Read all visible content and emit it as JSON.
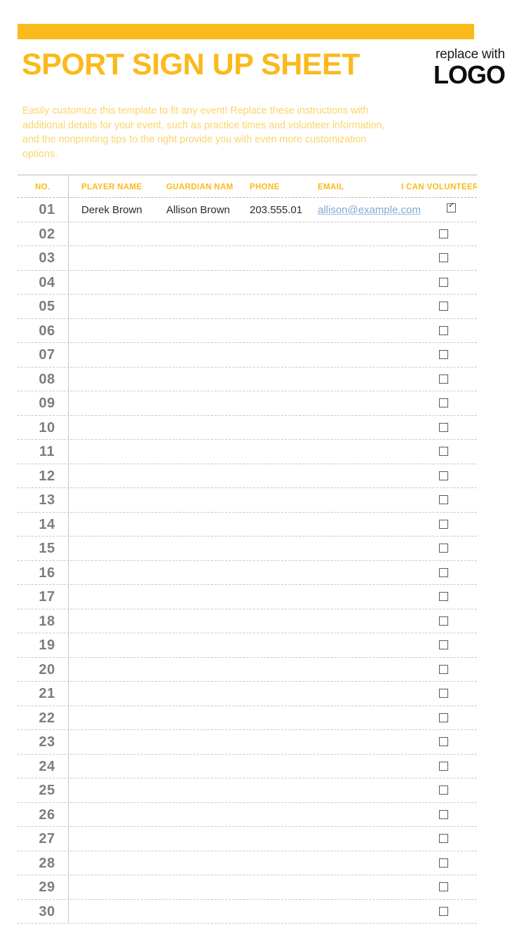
{
  "page": {
    "accent_color": "#FABA1B",
    "title": "SPORT SIGN UP SHEET",
    "intro": "Easily customize this template to fit any event! Replace these instructions with additional details for your event, such as practice times and volunteer information, and the nonprinting tips to the right provide you with even more customization options."
  },
  "logo": {
    "line1": "replace with",
    "line2": "LOGO"
  },
  "table": {
    "headers": {
      "no": "NO.",
      "player_name": "PLAYER NAME",
      "guardian_name": "GUARDIAN NAM",
      "phone": "PHONE",
      "email": "EMAIL",
      "volunteer": "I CAN VOLUNTEER"
    },
    "rows": [
      {
        "no": "01",
        "player_name": "Derek Brown",
        "guardian_name": "Allison Brown",
        "phone": "203.555.01",
        "email": "allison@example.com",
        "volunteer": true
      },
      {
        "no": "02",
        "player_name": "",
        "guardian_name": "",
        "phone": "",
        "email": "",
        "volunteer": false
      },
      {
        "no": "03",
        "player_name": "",
        "guardian_name": "",
        "phone": "",
        "email": "",
        "volunteer": false
      },
      {
        "no": "04",
        "player_name": "",
        "guardian_name": "",
        "phone": "",
        "email": "",
        "volunteer": false
      },
      {
        "no": "05",
        "player_name": "",
        "guardian_name": "",
        "phone": "",
        "email": "",
        "volunteer": false
      },
      {
        "no": "06",
        "player_name": "",
        "guardian_name": "",
        "phone": "",
        "email": "",
        "volunteer": false
      },
      {
        "no": "07",
        "player_name": "",
        "guardian_name": "",
        "phone": "",
        "email": "",
        "volunteer": false
      },
      {
        "no": "08",
        "player_name": "",
        "guardian_name": "",
        "phone": "",
        "email": "",
        "volunteer": false
      },
      {
        "no": "09",
        "player_name": "",
        "guardian_name": "",
        "phone": "",
        "email": "",
        "volunteer": false
      },
      {
        "no": "10",
        "player_name": "",
        "guardian_name": "",
        "phone": "",
        "email": "",
        "volunteer": false
      },
      {
        "no": "11",
        "player_name": "",
        "guardian_name": "",
        "phone": "",
        "email": "",
        "volunteer": false
      },
      {
        "no": "12",
        "player_name": "",
        "guardian_name": "",
        "phone": "",
        "email": "",
        "volunteer": false
      },
      {
        "no": "13",
        "player_name": "",
        "guardian_name": "",
        "phone": "",
        "email": "",
        "volunteer": false
      },
      {
        "no": "14",
        "player_name": "",
        "guardian_name": "",
        "phone": "",
        "email": "",
        "volunteer": false
      },
      {
        "no": "15",
        "player_name": "",
        "guardian_name": "",
        "phone": "",
        "email": "",
        "volunteer": false
      },
      {
        "no": "16",
        "player_name": "",
        "guardian_name": "",
        "phone": "",
        "email": "",
        "volunteer": false
      },
      {
        "no": "17",
        "player_name": "",
        "guardian_name": "",
        "phone": "",
        "email": "",
        "volunteer": false
      },
      {
        "no": "18",
        "player_name": "",
        "guardian_name": "",
        "phone": "",
        "email": "",
        "volunteer": false
      },
      {
        "no": "19",
        "player_name": "",
        "guardian_name": "",
        "phone": "",
        "email": "",
        "volunteer": false
      },
      {
        "no": "20",
        "player_name": "",
        "guardian_name": "",
        "phone": "",
        "email": "",
        "volunteer": false
      },
      {
        "no": "21",
        "player_name": "",
        "guardian_name": "",
        "phone": "",
        "email": "",
        "volunteer": false
      },
      {
        "no": "22",
        "player_name": "",
        "guardian_name": "",
        "phone": "",
        "email": "",
        "volunteer": false
      },
      {
        "no": "23",
        "player_name": "",
        "guardian_name": "",
        "phone": "",
        "email": "",
        "volunteer": false
      },
      {
        "no": "24",
        "player_name": "",
        "guardian_name": "",
        "phone": "",
        "email": "",
        "volunteer": false
      },
      {
        "no": "25",
        "player_name": "",
        "guardian_name": "",
        "phone": "",
        "email": "",
        "volunteer": false
      },
      {
        "no": "26",
        "player_name": "",
        "guardian_name": "",
        "phone": "",
        "email": "",
        "volunteer": false
      },
      {
        "no": "27",
        "player_name": "",
        "guardian_name": "",
        "phone": "",
        "email": "",
        "volunteer": false
      },
      {
        "no": "28",
        "player_name": "",
        "guardian_name": "",
        "phone": "",
        "email": "",
        "volunteer": false
      },
      {
        "no": "29",
        "player_name": "",
        "guardian_name": "",
        "phone": "",
        "email": "",
        "volunteer": false
      },
      {
        "no": "30",
        "player_name": "",
        "guardian_name": "",
        "phone": "",
        "email": "",
        "volunteer": false
      }
    ]
  }
}
